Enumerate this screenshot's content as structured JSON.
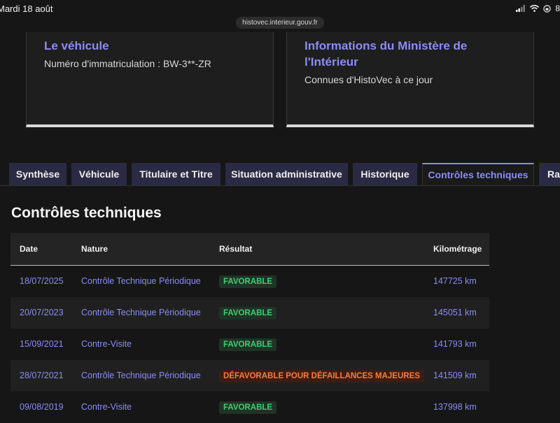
{
  "status_bar": {
    "time": "Mardi 18 août",
    "url": "histovec.interieur.gouv.fr",
    "battery": "8"
  },
  "cards": {
    "vehicle": {
      "title": "Le véhicule",
      "text": "Numéro d'immatriculation : BW-3**-ZR"
    },
    "ministry": {
      "title": "Informations du Ministère de l'Intérieur",
      "text": "Connues d'HistoVec à ce jour"
    }
  },
  "tabs": [
    {
      "label": "Synthèse"
    },
    {
      "label": "Véhicule"
    },
    {
      "label": "Titulaire et Titre"
    },
    {
      "label": "Situation administrative"
    },
    {
      "label": "Historique"
    },
    {
      "label": "Contrôles techniques"
    },
    {
      "label": "Rap"
    }
  ],
  "section": {
    "title": "Contrôles techniques"
  },
  "table": {
    "headers": [
      "Date",
      "Nature",
      "Résultat",
      "Kilométrage"
    ],
    "rows": [
      {
        "date": "18/07/2025",
        "nature": "Contrôle Technique Périodique",
        "result": "FAVORABLE",
        "km": "147725 km"
      },
      {
        "date": "20/07/2023",
        "nature": "Contrôle Technique Périodique",
        "result": "FAVORABLE",
        "km": "145051 km"
      },
      {
        "date": "15/09/2021",
        "nature": "Contre-Visite",
        "result": "FAVORABLE",
        "km": "141793 km"
      },
      {
        "date": "28/07/2021",
        "nature": "Contrôle Technique Périodique",
        "result": "DÉFAVORABLE POUR DÉFAILLANCES MAJEURES",
        "km": "141509 km"
      },
      {
        "date": "09/08/2019",
        "nature": "Contre-Visite",
        "result": "FAVORABLE",
        "km": "137998 km"
      }
    ]
  },
  "colors": {
    "accent": "#8b8cf5",
    "favorable": "#3fcf72",
    "defavorable": "#ff7a38"
  }
}
